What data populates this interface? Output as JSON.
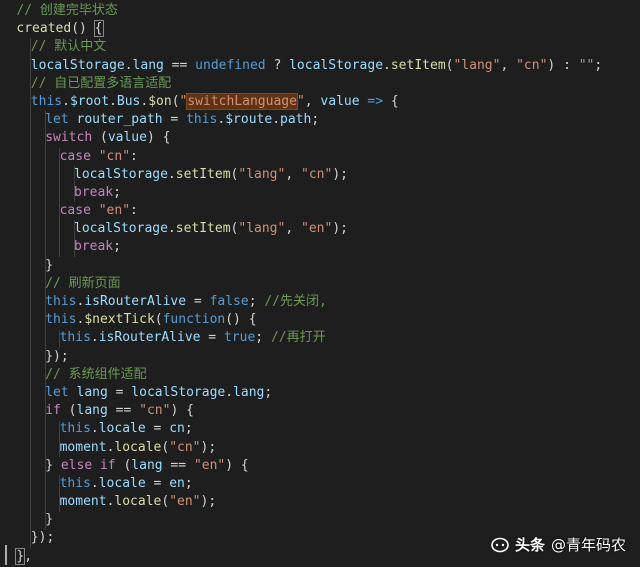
{
  "editor": {
    "theme_colors": {
      "background": "#1e1e1e",
      "comment": "#6a9955",
      "keyword": "#c586c0",
      "storage": "#569cd6",
      "string": "#ce9178",
      "function": "#dcdcaa",
      "variable": "#9cdcfe",
      "plain": "#d4d4d4",
      "highlight": "#613214"
    },
    "lines": [
      {
        "indent": 1,
        "tokens": [
          {
            "t": "comment",
            "v": "// 创建完毕状态"
          }
        ]
      },
      {
        "indent": 1,
        "tokens": [
          {
            "t": "func",
            "v": "created"
          },
          {
            "t": "plain",
            "v": "() "
          },
          {
            "t": "plain",
            "v": "{",
            "mark": "bracket"
          }
        ]
      },
      {
        "indent": 2,
        "tokens": [
          {
            "t": "comment",
            "v": "// 默认中文"
          }
        ]
      },
      {
        "indent": 2,
        "tokens": [
          {
            "t": "var",
            "v": "localStorage"
          },
          {
            "t": "plain",
            "v": "."
          },
          {
            "t": "var",
            "v": "lang"
          },
          {
            "t": "plain",
            "v": " == "
          },
          {
            "t": "storage",
            "v": "undefined"
          },
          {
            "t": "plain",
            "v": " ? "
          },
          {
            "t": "var",
            "v": "localStorage"
          },
          {
            "t": "plain",
            "v": "."
          },
          {
            "t": "func",
            "v": "setItem"
          },
          {
            "t": "plain",
            "v": "("
          },
          {
            "t": "string",
            "v": "\"lang\""
          },
          {
            "t": "plain",
            "v": ", "
          },
          {
            "t": "string",
            "v": "\"cn\""
          },
          {
            "t": "plain",
            "v": ") : "
          },
          {
            "t": "string",
            "v": "\"\""
          },
          {
            "t": "plain",
            "v": ";"
          }
        ]
      },
      {
        "indent": 2,
        "tokens": [
          {
            "t": "comment",
            "v": "// 自已配置多语言适配"
          }
        ]
      },
      {
        "indent": 2,
        "tokens": [
          {
            "t": "storage",
            "v": "this"
          },
          {
            "t": "plain",
            "v": "."
          },
          {
            "t": "var",
            "v": "$root"
          },
          {
            "t": "plain",
            "v": "."
          },
          {
            "t": "var",
            "v": "Bus"
          },
          {
            "t": "plain",
            "v": "."
          },
          {
            "t": "func",
            "v": "$on"
          },
          {
            "t": "plain",
            "v": "("
          },
          {
            "t": "string",
            "v": "\""
          },
          {
            "t": "string",
            "v": "switchLanguage",
            "mark": "highlight"
          },
          {
            "t": "string",
            "v": "\""
          },
          {
            "t": "plain",
            "v": ", "
          },
          {
            "t": "var",
            "v": "value"
          },
          {
            "t": "storage",
            "v": " =>"
          },
          {
            "t": "plain",
            "v": " {"
          }
        ]
      },
      {
        "indent": 3,
        "tokens": [
          {
            "t": "storage",
            "v": "let"
          },
          {
            "t": "plain",
            "v": " "
          },
          {
            "t": "var",
            "v": "router_path"
          },
          {
            "t": "plain",
            "v": " = "
          },
          {
            "t": "storage",
            "v": "this"
          },
          {
            "t": "plain",
            "v": "."
          },
          {
            "t": "var",
            "v": "$route"
          },
          {
            "t": "plain",
            "v": "."
          },
          {
            "t": "var",
            "v": "path"
          },
          {
            "t": "plain",
            "v": ";"
          }
        ]
      },
      {
        "indent": 3,
        "tokens": [
          {
            "t": "keyword",
            "v": "switch"
          },
          {
            "t": "plain",
            "v": " ("
          },
          {
            "t": "var",
            "v": "value"
          },
          {
            "t": "plain",
            "v": ") {"
          }
        ]
      },
      {
        "indent": 4,
        "tokens": [
          {
            "t": "keyword",
            "v": "case"
          },
          {
            "t": "plain",
            "v": " "
          },
          {
            "t": "string",
            "v": "\"cn\""
          },
          {
            "t": "plain",
            "v": ":"
          }
        ]
      },
      {
        "indent": 5,
        "tokens": [
          {
            "t": "var",
            "v": "localStorage"
          },
          {
            "t": "plain",
            "v": "."
          },
          {
            "t": "func",
            "v": "setItem"
          },
          {
            "t": "plain",
            "v": "("
          },
          {
            "t": "string",
            "v": "\"lang\""
          },
          {
            "t": "plain",
            "v": ", "
          },
          {
            "t": "string",
            "v": "\"cn\""
          },
          {
            "t": "plain",
            "v": ");"
          }
        ]
      },
      {
        "indent": 5,
        "tokens": [
          {
            "t": "keyword",
            "v": "break"
          },
          {
            "t": "plain",
            "v": ";"
          }
        ]
      },
      {
        "indent": 4,
        "tokens": [
          {
            "t": "keyword",
            "v": "case"
          },
          {
            "t": "plain",
            "v": " "
          },
          {
            "t": "string",
            "v": "\"en\""
          },
          {
            "t": "plain",
            "v": ":"
          }
        ]
      },
      {
        "indent": 5,
        "tokens": [
          {
            "t": "var",
            "v": "localStorage"
          },
          {
            "t": "plain",
            "v": "."
          },
          {
            "t": "func",
            "v": "setItem"
          },
          {
            "t": "plain",
            "v": "("
          },
          {
            "t": "string",
            "v": "\"lang\""
          },
          {
            "t": "plain",
            "v": ", "
          },
          {
            "t": "string",
            "v": "\"en\""
          },
          {
            "t": "plain",
            "v": ");"
          }
        ]
      },
      {
        "indent": 5,
        "tokens": [
          {
            "t": "keyword",
            "v": "break"
          },
          {
            "t": "plain",
            "v": ";"
          }
        ]
      },
      {
        "indent": 3,
        "tokens": [
          {
            "t": "plain",
            "v": "}"
          }
        ]
      },
      {
        "indent": 3,
        "tokens": [
          {
            "t": "comment",
            "v": "// 刷新页面"
          }
        ]
      },
      {
        "indent": 3,
        "tokens": [
          {
            "t": "storage",
            "v": "this"
          },
          {
            "t": "plain",
            "v": "."
          },
          {
            "t": "var",
            "v": "isRouterAlive"
          },
          {
            "t": "plain",
            "v": " = "
          },
          {
            "t": "storage",
            "v": "false"
          },
          {
            "t": "plain",
            "v": "; "
          },
          {
            "t": "comment",
            "v": "//先关闭,"
          }
        ]
      },
      {
        "indent": 3,
        "tokens": [
          {
            "t": "storage",
            "v": "this"
          },
          {
            "t": "plain",
            "v": "."
          },
          {
            "t": "func",
            "v": "$nextTick"
          },
          {
            "t": "plain",
            "v": "("
          },
          {
            "t": "storage",
            "v": "function"
          },
          {
            "t": "plain",
            "v": "() {"
          }
        ]
      },
      {
        "indent": 4,
        "tokens": [
          {
            "t": "storage",
            "v": "this"
          },
          {
            "t": "plain",
            "v": "."
          },
          {
            "t": "var",
            "v": "isRouterAlive"
          },
          {
            "t": "plain",
            "v": " = "
          },
          {
            "t": "storage",
            "v": "true"
          },
          {
            "t": "plain",
            "v": "; "
          },
          {
            "t": "comment",
            "v": "//再打开"
          }
        ]
      },
      {
        "indent": 3,
        "tokens": [
          {
            "t": "plain",
            "v": "});"
          }
        ]
      },
      {
        "indent": 3,
        "tokens": [
          {
            "t": "comment",
            "v": "// 系统组件适配"
          }
        ]
      },
      {
        "indent": 3,
        "tokens": [
          {
            "t": "storage",
            "v": "let"
          },
          {
            "t": "plain",
            "v": " "
          },
          {
            "t": "var",
            "v": "lang"
          },
          {
            "t": "plain",
            "v": " = "
          },
          {
            "t": "var",
            "v": "localStorage"
          },
          {
            "t": "plain",
            "v": "."
          },
          {
            "t": "var",
            "v": "lang"
          },
          {
            "t": "plain",
            "v": ";"
          }
        ]
      },
      {
        "indent": 3,
        "tokens": [
          {
            "t": "keyword",
            "v": "if"
          },
          {
            "t": "plain",
            "v": " ("
          },
          {
            "t": "var",
            "v": "lang"
          },
          {
            "t": "plain",
            "v": " == "
          },
          {
            "t": "string",
            "v": "\"cn\""
          },
          {
            "t": "plain",
            "v": ") {"
          }
        ]
      },
      {
        "indent": 4,
        "tokens": [
          {
            "t": "storage",
            "v": "this"
          },
          {
            "t": "plain",
            "v": "."
          },
          {
            "t": "var",
            "v": "locale"
          },
          {
            "t": "plain",
            "v": " = "
          },
          {
            "t": "var",
            "v": "cn"
          },
          {
            "t": "plain",
            "v": ";"
          }
        ]
      },
      {
        "indent": 4,
        "tokens": [
          {
            "t": "var",
            "v": "moment"
          },
          {
            "t": "plain",
            "v": "."
          },
          {
            "t": "func",
            "v": "locale"
          },
          {
            "t": "plain",
            "v": "("
          },
          {
            "t": "string",
            "v": "\"cn\""
          },
          {
            "t": "plain",
            "v": ");"
          }
        ]
      },
      {
        "indent": 3,
        "tokens": [
          {
            "t": "plain",
            "v": "} "
          },
          {
            "t": "keyword",
            "v": "else"
          },
          {
            "t": "plain",
            "v": " "
          },
          {
            "t": "keyword",
            "v": "if"
          },
          {
            "t": "plain",
            "v": " ("
          },
          {
            "t": "var",
            "v": "lang"
          },
          {
            "t": "plain",
            "v": " == "
          },
          {
            "t": "string",
            "v": "\"en\""
          },
          {
            "t": "plain",
            "v": ") {"
          }
        ]
      },
      {
        "indent": 4,
        "tokens": [
          {
            "t": "storage",
            "v": "this"
          },
          {
            "t": "plain",
            "v": "."
          },
          {
            "t": "var",
            "v": "locale"
          },
          {
            "t": "plain",
            "v": " = "
          },
          {
            "t": "var",
            "v": "en"
          },
          {
            "t": "plain",
            "v": ";"
          }
        ]
      },
      {
        "indent": 4,
        "tokens": [
          {
            "t": "var",
            "v": "moment"
          },
          {
            "t": "plain",
            "v": "."
          },
          {
            "t": "func",
            "v": "locale"
          },
          {
            "t": "plain",
            "v": "("
          },
          {
            "t": "string",
            "v": "\"en\""
          },
          {
            "t": "plain",
            "v": ");"
          }
        ]
      },
      {
        "indent": 3,
        "tokens": [
          {
            "t": "plain",
            "v": "}"
          }
        ]
      },
      {
        "indent": 2,
        "tokens": [
          {
            "t": "plain",
            "v": "});"
          }
        ]
      },
      {
        "indent": 1,
        "tokens": [
          {
            "t": "plain",
            "v": "}",
            "mark": "bracket"
          },
          {
            "t": "plain",
            "v": ","
          }
        ]
      }
    ]
  },
  "watermark": {
    "source": "头条",
    "handle": "@青年码农",
    "logo_icon": "circle-logo-icon"
  }
}
